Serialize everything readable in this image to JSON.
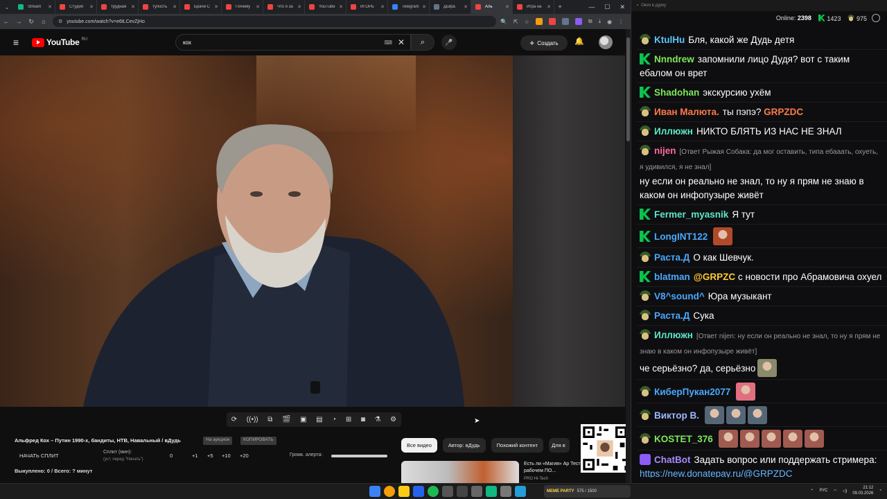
{
  "browser": {
    "tabs": [
      {
        "label": "Stream",
        "color": "#10b981"
      },
      {
        "label": "Студия",
        "color": "#ef4444"
      },
      {
        "label": "трудная",
        "color": "#ef4444"
      },
      {
        "label": "тупость",
        "color": "#ef4444"
      },
      {
        "label": "Брачи С",
        "color": "#ef4444"
      },
      {
        "label": "Почему",
        "color": "#ef4444"
      },
      {
        "label": "Что я за",
        "color": "#ef4444"
      },
      {
        "label": "YouTube",
        "color": "#ef4444"
      },
      {
        "label": "ИГОРЬ",
        "color": "#ef4444"
      },
      {
        "label": "Telegram",
        "color": "#3b82f6"
      },
      {
        "label": "Дшlра",
        "color": "#64748b"
      },
      {
        "label": "Аль",
        "color": "#ef4444",
        "active": true
      },
      {
        "label": "Игра на",
        "color": "#ef4444"
      }
    ],
    "url": "youtube.com/watch?v=e6tLCevZjHo"
  },
  "youtube": {
    "logo": "YouTube",
    "region": "RU",
    "search_value": "кох",
    "create_label": "Создать",
    "video_title": "Альфред Кох – Путин 1990-х, бандиты, НТВ, Навальный / вДудь",
    "pill1": "На аукцион",
    "pill2": "КОПИРОВАТЬ",
    "split_start": "НАЧАТЬ СПЛИТ",
    "split_label": "Сплит (мин):",
    "split_sub": "(уст. перед \"Начать\")",
    "split_values": [
      "0",
      "+1",
      "+5",
      "+10",
      "+20"
    ],
    "alert_label": "Громк. алерта:",
    "alert_volume": 1.0,
    "bought": "Выкуплено: 0 / Всего: ? минут",
    "chips": [
      "Все видео",
      "Автор: вДудь",
      "Похожий контент",
      "Для в"
    ],
    "rec_title": "Есть ли «Магия» Ар Тест в играх и рабочем ПО...",
    "rec_sub": "PRO Hi-Tech"
  },
  "chat": {
    "window_title": "Окно в дурку",
    "online_label": "Online:",
    "online_count": "2398",
    "kick_count": "1423",
    "points_count": "975",
    "messages": [
      {
        "badge": "hat",
        "user": "KtulHu",
        "color": "#5cc6ff",
        "text": "Бля, какой же Дудь детя"
      },
      {
        "badge": "k",
        "user": "Nnndrew",
        "color": "#7ee85a",
        "text": "запомнили лицо Дудя? вот с таким ебалом он врет"
      },
      {
        "badge": "k",
        "user": "Shadohan",
        "color": "#7ee85a",
        "text": "экскурсию ухём"
      },
      {
        "badge": "hat",
        "user": "Иван Малюта.",
        "color": "#ff7a4a",
        "text": "ты пэпэ?",
        "mention": "GRPZDC",
        "mention_color": "#ff7a4a"
      },
      {
        "badge": "hat",
        "user": "Иллюжн",
        "color": "#5ee8c8",
        "text": "НИКТО БЛЯТЬ ИЗ НАС НЕ ЗНАЛ"
      },
      {
        "badge": "hat",
        "user": "nijen",
        "color": "#ff6aa0",
        "reply": "[Ответ Рыжая Собака: да мог оставить, типа ебааать, охуеть, я удивился, я не знал]",
        "text": "ну если он реально не знал, то ну я прям не знаю в каком он инфопузыре живёт"
      },
      {
        "badge": "k",
        "user": "Fermer_myasnik",
        "color": "#5ee8c8",
        "text": "Я тут"
      },
      {
        "badge": "k",
        "user": "LongINT122",
        "color": "#4aa8ff",
        "text": "",
        "emote": "#b04a2a"
      },
      {
        "badge": "hat",
        "user": "Раста.Д",
        "color": "#4aa8ff",
        "text": "О как Шевчук."
      },
      {
        "badge": "k",
        "user": "blatman",
        "color": "#4aa8ff",
        "mention": "@GRPZC",
        "mention_color": "#ffcc33",
        "text": "с новости про Абрамовича охуел"
      },
      {
        "badge": "hat",
        "user": "V8^sound^",
        "color": "#4aa8ff",
        "text": "Юра музыкант"
      },
      {
        "badge": "hat",
        "user": "Раста.Д",
        "color": "#4aa8ff",
        "text": "Сука"
      },
      {
        "badge": "hat",
        "user": "Иллюжн",
        "color": "#5ee8c8",
        "reply": "[Ответ nijen: ну если он реально не знал, то ну я прям не знаю в каком он инфопузыре живёт]",
        "text": "че серьёзно? да, серьёзно",
        "emote": "#8a8a6a"
      },
      {
        "badge": "hat",
        "user": "КиберПукан2077",
        "color": "#4aa8ff",
        "text": "",
        "emote": "#e07080"
      },
      {
        "badge": "hat",
        "user": "Виктор В.",
        "color": "#9ab8ff",
        "text": "",
        "emotes": 3,
        "emote": "#556677"
      },
      {
        "badge": "hat",
        "user": "KOSTET_376",
        "color": "#7ee85a",
        "text": "",
        "emotes": 5,
        "emote": "#a05a50"
      },
      {
        "badge": "bot",
        "user": "ChatBot",
        "color": "#a58bff",
        "text": "Задать вопрос или поддержать стримера:",
        "link": "https://new.donatepay.ru/@GRPZDC"
      }
    ]
  },
  "taskbar": {
    "widget_name": "MEME PARTY",
    "widget_value": "575 / 1500",
    "lang": "РУС",
    "time": "21:12",
    "date": "09.03.2026"
  }
}
